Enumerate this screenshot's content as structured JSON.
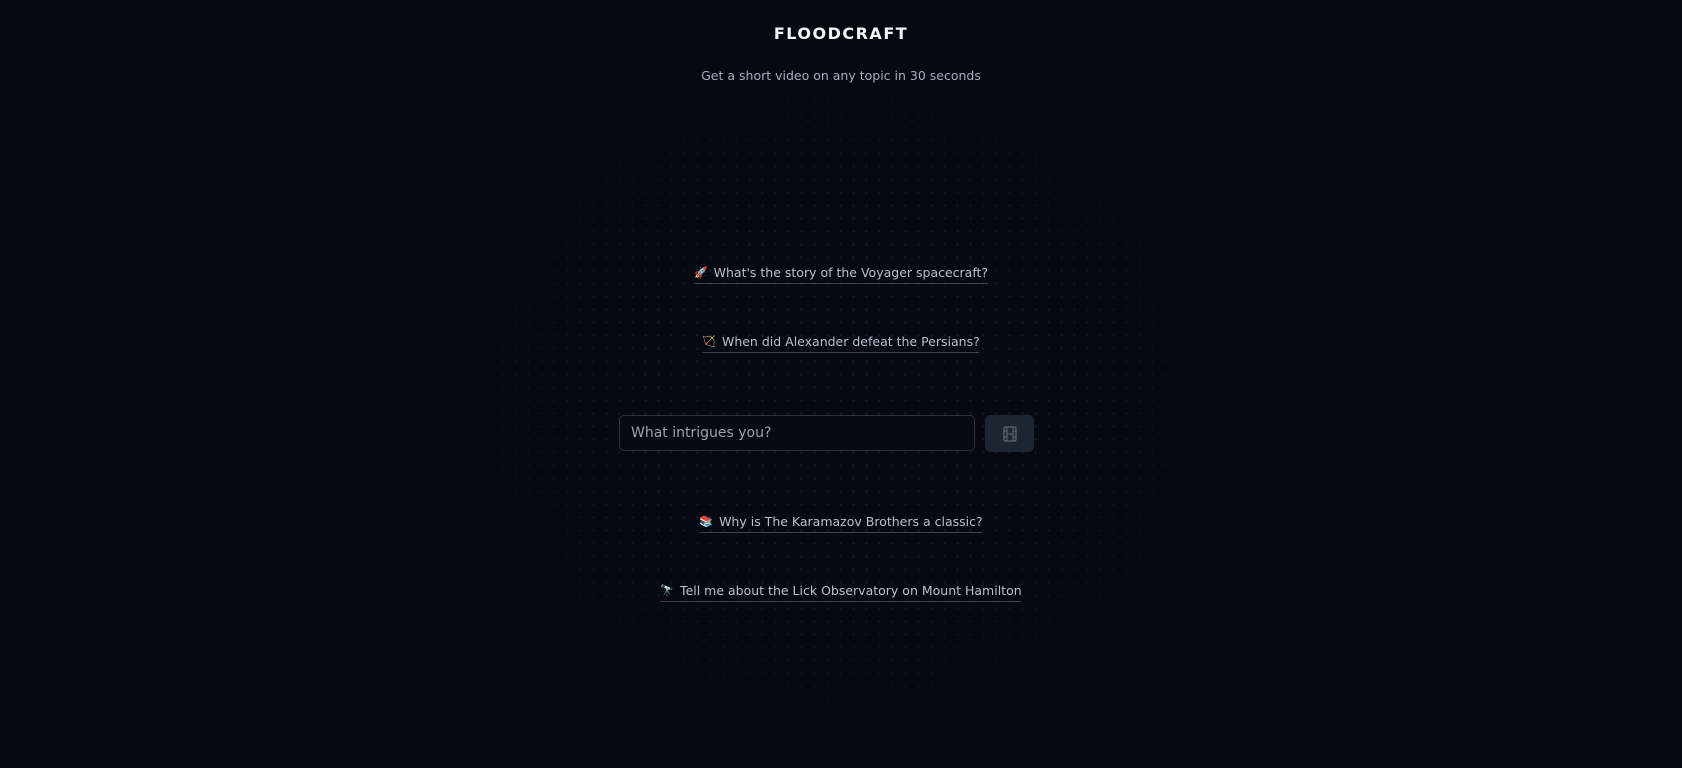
{
  "header": {
    "title": "FLOODCRAFT",
    "subtitle": "Get a short video on any topic in 30 seconds"
  },
  "suggestions": [
    {
      "emoji": "🚀",
      "icon": "rocket-icon",
      "text": "What's the story of the Voyager spacecraft?"
    },
    {
      "emoji": "🏹",
      "icon": "bow-and-arrow-icon",
      "text": "When did Alexander defeat the Persians?"
    },
    {
      "emoji": "📚",
      "icon": "books-icon",
      "text": "Why is The Karamazov Brothers a classic?"
    },
    {
      "emoji": "🔭",
      "icon": "telescope-icon",
      "text": "Tell me about the Lick Observatory on Mount Hamilton"
    }
  ],
  "prompt": {
    "placeholder": "What intrigues you?",
    "value": "",
    "submit_icon": "film-icon"
  },
  "colors": {
    "background": "#050a12",
    "title": "#f4f6f9",
    "text_muted": "#a6aebb",
    "button_bg": "#1d2530"
  }
}
